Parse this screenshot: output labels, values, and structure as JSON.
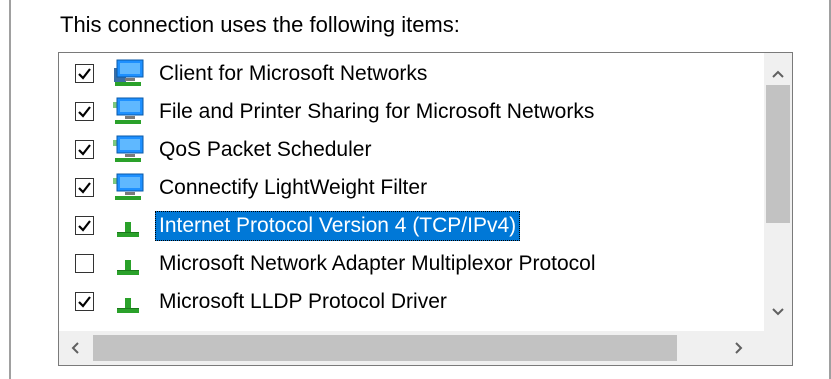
{
  "heading": "This connection uses the following items:",
  "items": [
    {
      "label": "Client for Microsoft Networks",
      "checked": true,
      "icon": "network-client-icon",
      "selected": false
    },
    {
      "label": "File and Printer Sharing for Microsoft Networks",
      "checked": true,
      "icon": "network-service-icon",
      "selected": false
    },
    {
      "label": "QoS Packet Scheduler",
      "checked": true,
      "icon": "network-service-icon",
      "selected": false
    },
    {
      "label": "Connectify LightWeight Filter",
      "checked": true,
      "icon": "network-service-icon",
      "selected": false
    },
    {
      "label": "Internet Protocol Version 4 (TCP/IPv4)",
      "checked": true,
      "icon": "protocol-icon",
      "selected": true
    },
    {
      "label": "Microsoft Network Adapter Multiplexor Protocol",
      "checked": false,
      "icon": "protocol-icon",
      "selected": false
    },
    {
      "label": "Microsoft LLDP Protocol Driver",
      "checked": true,
      "icon": "protocol-icon",
      "selected": false
    }
  ],
  "scrollbar_icons": {
    "up": "chevron-up-icon",
    "down": "chevron-down-icon",
    "left": "chevron-left-icon",
    "right": "chevron-right-icon"
  },
  "colors": {
    "selection": "#0078d7",
    "scrollbar_track": "#f0f0f0",
    "scrollbar_thumb": "#c2c2c2"
  }
}
